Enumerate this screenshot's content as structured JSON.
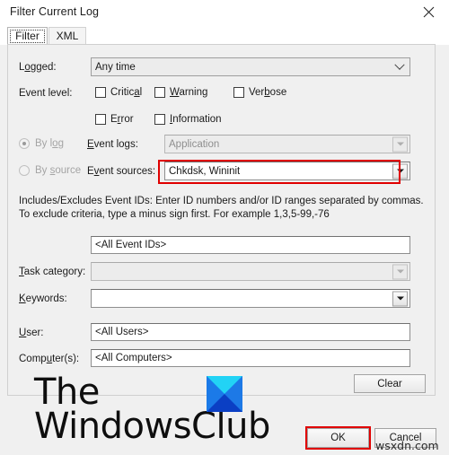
{
  "window": {
    "title": "Filter Current Log",
    "close_icon": "close-icon"
  },
  "tabs": [
    {
      "label": "Filter",
      "active": true
    },
    {
      "label": "XML",
      "active": false
    }
  ],
  "form": {
    "logged": {
      "label": "Logged:",
      "value": "Any time"
    },
    "event_level": {
      "label": "Event level:",
      "options": [
        {
          "label": "Critical",
          "checked": false
        },
        {
          "label": "Warning",
          "checked": false
        },
        {
          "label": "Verbose",
          "checked": false
        },
        {
          "label": "Error",
          "checked": false
        },
        {
          "label": "Information",
          "checked": false
        }
      ]
    },
    "source_mode": {
      "by_log": {
        "label": "By log",
        "selected": true,
        "enabled": false
      },
      "by_source": {
        "label": "By source",
        "selected": false,
        "enabled": false
      }
    },
    "event_logs": {
      "label": "Event logs:",
      "value": "Application",
      "enabled": false
    },
    "event_sources": {
      "label": "Event sources:",
      "value": "Chkdsk, Wininit",
      "enabled": true,
      "highlighted": true
    },
    "event_ids": {
      "help": "Includes/Excludes Event IDs: Enter ID numbers and/or ID ranges separated by commas. To exclude criteria, type a minus sign first. For example 1,3,5-99,-76",
      "value": "<All Event IDs>"
    },
    "task_category": {
      "label": "Task category:",
      "value": "",
      "enabled": false
    },
    "keywords": {
      "label": "Keywords:",
      "value": "",
      "enabled": true
    },
    "user": {
      "label": "User:",
      "value": "<All Users>"
    },
    "computers": {
      "label": "Computer(s):",
      "value": "<All Computers>"
    }
  },
  "buttons": {
    "clear": "Clear",
    "ok": "OK",
    "cancel": "Cancel"
  },
  "watermark": {
    "line1": "The",
    "line2": "WindowsClub",
    "logo_colors": {
      "top": "#22d3f5",
      "left": "#1b7ae8",
      "right": "#1d79e6",
      "bottom": "#0b3fc4"
    },
    "site": "wsxdn.com"
  },
  "annotations": {
    "highlight_color": "#e00000"
  }
}
